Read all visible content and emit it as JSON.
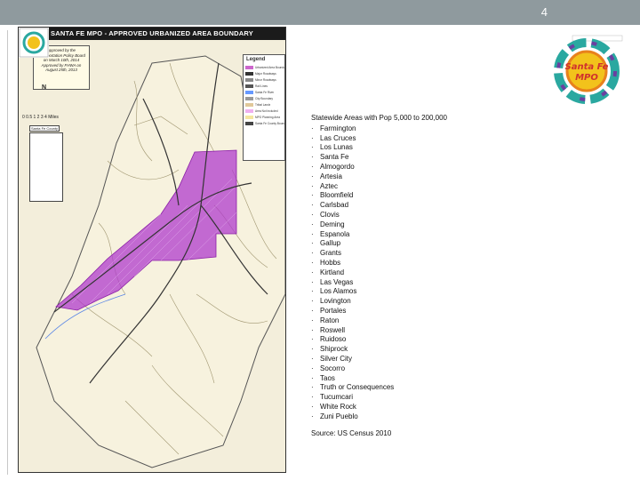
{
  "slide": {
    "number": "4"
  },
  "map": {
    "title": "SANTA FE MPO - APPROVED URBANIZED AREA BOUNDARY",
    "approval_lines": [
      "Approved by the",
      "Transportation Policy Board",
      "on March 10th, 2014",
      "Approved by FHWA on",
      "August 25th, 2013"
    ],
    "legend": {
      "title": "Legend",
      "items": [
        {
          "label": "Urbanized Area Boundary",
          "color": "#cc66cc"
        },
        {
          "label": "Major Roadways",
          "color": "#333333"
        },
        {
          "label": "Minor Roadways",
          "color": "#888888"
        },
        {
          "label": "Rail Lines",
          "color": "#555555"
        },
        {
          "label": "Santa Fe River",
          "color": "#6699ff"
        },
        {
          "label": "City Boundary",
          "color": "#999999"
        },
        {
          "label": "Tribal Lands",
          "color": "#e0c89a"
        },
        {
          "label": "Area Not Included",
          "color": "#f0b0f0"
        },
        {
          "label": "MPO Planning Area",
          "color": "#f5e6a0"
        },
        {
          "label": "Santa Fe County Boundary",
          "color": "#444444"
        }
      ]
    },
    "north_label": "N",
    "scale_label": "0 0.5 1 2 3 4 Miles",
    "inset_label": "Santa Fe County",
    "colors": {
      "urbanized": "#b03bcc",
      "background": "#f3eedb",
      "roads": "#8a8060",
      "major_roads": "#3c3c3c"
    }
  },
  "content": {
    "heading": "Statewide Areas with Pop 5,000 to 200,000",
    "cities": [
      "Farmington",
      "Las Cruces",
      "Los Lunas",
      "Santa Fe",
      "Almogordo",
      "Artesia",
      "Aztec",
      "Bloomfield",
      "Carlsbad",
      "Clovis",
      "Deming",
      "Espanola",
      "Gallup",
      "Grants",
      "Hobbs",
      "Kirtland",
      "Las Vegas",
      "Los Alamos",
      "Lovington",
      "Portales",
      "Raton",
      "Roswell",
      "Ruidoso",
      "Shiprock",
      "Silver City",
      "Socorro",
      "Taos",
      "Truth or Consequences",
      "Tucumcari",
      "White Rock",
      "Zuni Pueblo"
    ],
    "source": "Source: US Census 2010"
  },
  "logo": {
    "line1": "Santa Fe",
    "line2": "MPO",
    "colors": {
      "text": "#d0312d",
      "teal": "#2aa8a0",
      "orange": "#e8811c",
      "purple": "#6b3fa0",
      "yellow": "#f2c21b"
    }
  }
}
